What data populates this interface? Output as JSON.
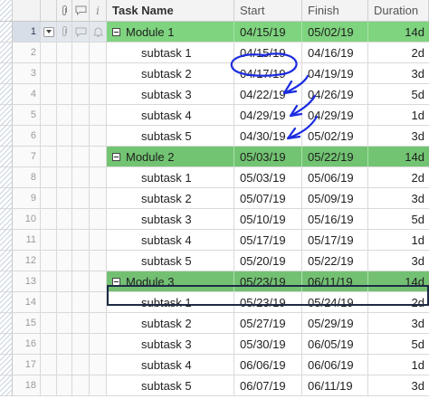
{
  "header": {
    "task_name": "Task Name",
    "start": "Start",
    "finish": "Finish",
    "duration": "Duration",
    "info_glyph": "i",
    "icons": [
      "paperclip-icon",
      "comment-icon",
      "info-icon"
    ]
  },
  "colors": {
    "parent_row": "#7fd47f",
    "selected_outline": "#1d2b45",
    "annotation_ink": "#1b2be0"
  },
  "rows": [
    {
      "num": "1",
      "task": "Module 1",
      "start": "04/15/19",
      "finish": "05/02/19",
      "duration": "14d",
      "parent": true
    },
    {
      "num": "2",
      "task": "subtask 1",
      "start": "04/15/19",
      "finish": "04/16/19",
      "duration": "2d"
    },
    {
      "num": "3",
      "task": "subtask 2",
      "start": "04/17/19",
      "finish": "04/19/19",
      "duration": "3d"
    },
    {
      "num": "4",
      "task": "subtask 3",
      "start": "04/22/19",
      "finish": "04/26/19",
      "duration": "5d"
    },
    {
      "num": "5",
      "task": "subtask 4",
      "start": "04/29/19",
      "finish": "04/29/19",
      "duration": "1d"
    },
    {
      "num": "6",
      "task": "subtask 5",
      "start": "04/30/19",
      "finish": "05/02/19",
      "duration": "3d"
    },
    {
      "num": "7",
      "task": "Module 2",
      "start": "05/03/19",
      "finish": "05/22/19",
      "duration": "14d",
      "parent": true
    },
    {
      "num": "8",
      "task": "subtask 1",
      "start": "05/03/19",
      "finish": "05/06/19",
      "duration": "2d"
    },
    {
      "num": "9",
      "task": "subtask 2",
      "start": "05/07/19",
      "finish": "05/09/19",
      "duration": "3d"
    },
    {
      "num": "10",
      "task": "subtask 3",
      "start": "05/10/19",
      "finish": "05/16/19",
      "duration": "5d"
    },
    {
      "num": "11",
      "task": "subtask 4",
      "start": "05/17/19",
      "finish": "05/17/19",
      "duration": "1d"
    },
    {
      "num": "12",
      "task": "subtask 5",
      "start": "05/20/19",
      "finish": "05/22/19",
      "duration": "3d"
    },
    {
      "num": "13",
      "task": "Module 3",
      "start": "05/23/19",
      "finish": "06/11/19",
      "duration": "14d",
      "parent": true
    },
    {
      "num": "14",
      "task": "subtask 1",
      "start": "05/23/19",
      "finish": "05/24/19",
      "duration": "2d"
    },
    {
      "num": "15",
      "task": "subtask 2",
      "start": "05/27/19",
      "finish": "05/29/19",
      "duration": "3d"
    },
    {
      "num": "16",
      "task": "subtask 3",
      "start": "05/30/19",
      "finish": "06/05/19",
      "duration": "5d"
    },
    {
      "num": "17",
      "task": "subtask 4",
      "start": "06/06/19",
      "finish": "06/06/19",
      "duration": "1d"
    },
    {
      "num": "18",
      "task": "subtask 5",
      "start": "06/07/19",
      "finish": "06/11/19",
      "duration": "3d"
    }
  ]
}
